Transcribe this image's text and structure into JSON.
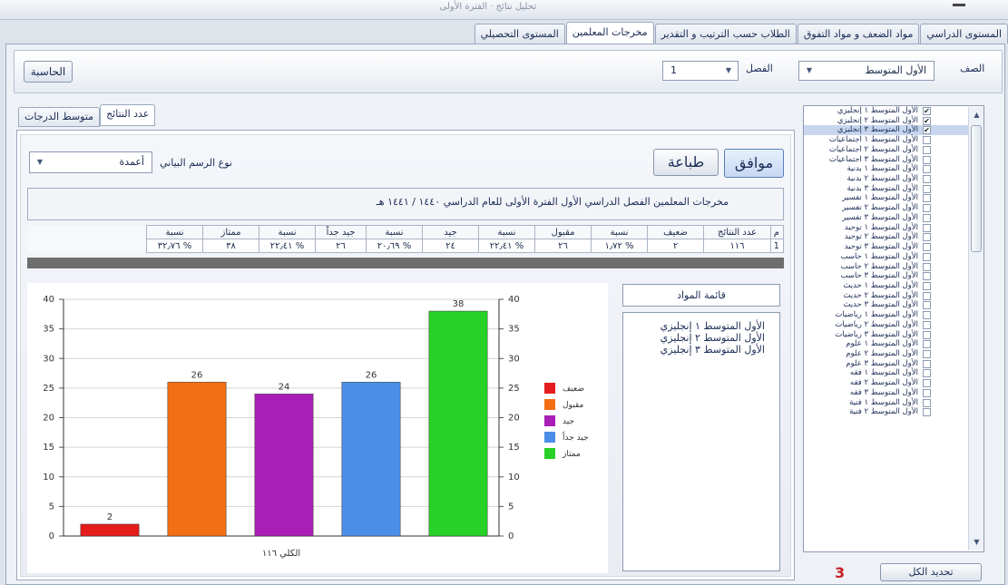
{
  "window": {
    "title": "تحليل نتائج · الفترة الأولى"
  },
  "main_tabs": [
    {
      "label": "المستوى الدراسي",
      "active": false
    },
    {
      "label": "مواد الضعف و مواد التفوق",
      "active": false
    },
    {
      "label": "الطلاب حسب الترتيب و التقدير",
      "active": false
    },
    {
      "label": "مخرجات المعلمين",
      "active": true
    },
    {
      "label": "المستوى التحصيلي",
      "active": false
    }
  ],
  "toolbar": {
    "class_label": "الصف",
    "class_value": "الأول المتوسط",
    "section_label": "الفصل",
    "section_value": "1",
    "calc_button": "الحاسبة"
  },
  "sub_tabs": [
    {
      "label": "متوسط الدرجات",
      "active": false
    },
    {
      "label": "عدد النتائج",
      "active": true
    }
  ],
  "chart_controls": {
    "type_label": "نوع الرسم البياني",
    "type_value": "أعمدة",
    "print_button": "طباعة",
    "ok_button": "موافق"
  },
  "report_title": "مخرجات المعلمين الفصل الدراسي الأول الفترة الأولى للعام الدراسي ١٤٤٠ / ١٤٤١ هـ",
  "stats_table": {
    "headers": [
      "م",
      "عدد النتائج",
      "ضعيف",
      "نسبة",
      "مقبول",
      "نسبة",
      "جيد",
      "نسبة",
      "جيد جداً",
      "نسبة",
      "ممتاز",
      "نسبة"
    ],
    "row": [
      "1",
      "١١٦",
      "٢",
      "% ١٫٧٢",
      "٢٦",
      "% ٢٢٫٤١",
      "٢٤",
      "% ٢٠٫٦٩",
      "٢٦",
      "% ٢٢٫٤١",
      "٣٨",
      "% ٣٢٫٧٦"
    ]
  },
  "chart_data": {
    "type": "bar",
    "categories": [
      "ضعيف",
      "مقبول",
      "جيد",
      "جيد جداً",
      "ممتاز"
    ],
    "values": [
      2,
      26,
      24,
      26,
      38
    ],
    "colors": [
      "#e41c1c",
      "#f36f13",
      "#a91eb6",
      "#4a8ee8",
      "#27d127"
    ],
    "ylim": [
      0,
      40
    ],
    "yticks": [
      "0",
      "5",
      "10",
      "15",
      "20",
      "25",
      "30",
      "35",
      "40"
    ],
    "xlabel": "الكلي ١١٦",
    "grid": true,
    "legend": "right"
  },
  "subjects": {
    "header": "قائمة المواد",
    "items": [
      "الأول المتوسط ١ إنجليزي",
      "الأول المتوسط ٢ إنجليزي",
      "الأول المتوسط ٣ إنجليزي"
    ]
  },
  "class_list": [
    {
      "label": "الأول المتوسط ١ إنجليزي",
      "checked": true,
      "selected": false
    },
    {
      "label": "الأول المتوسط ٢ إنجليزي",
      "checked": true,
      "selected": false
    },
    {
      "label": "الأول المتوسط ٣ إنجليزي",
      "checked": true,
      "selected": true
    },
    {
      "label": "الأول المتوسط ١ اجتماعيات",
      "checked": false,
      "selected": false
    },
    {
      "label": "الأول المتوسط ٢ اجتماعيات",
      "checked": false,
      "selected": false
    },
    {
      "label": "الأول المتوسط ٣ اجتماعيات",
      "checked": false,
      "selected": false
    },
    {
      "label": "الأول المتوسط ١ بدنية",
      "checked": false,
      "selected": false
    },
    {
      "label": "الأول المتوسط ٢ بدنية",
      "checked": false,
      "selected": false
    },
    {
      "label": "الأول المتوسط ٣ بدنية",
      "checked": false,
      "selected": false
    },
    {
      "label": "الأول المتوسط ١ تفسير",
      "checked": false,
      "selected": false
    },
    {
      "label": "الأول المتوسط ٢ تفسير",
      "checked": false,
      "selected": false
    },
    {
      "label": "الأول المتوسط ٣ تفسير",
      "checked": false,
      "selected": false
    },
    {
      "label": "الأول المتوسط ١ توحيد",
      "checked": false,
      "selected": false
    },
    {
      "label": "الأول المتوسط ٢ توحيد",
      "checked": false,
      "selected": false
    },
    {
      "label": "الأول المتوسط ٣ توحيد",
      "checked": false,
      "selected": false
    },
    {
      "label": "الأول المتوسط ١ حاسب",
      "checked": false,
      "selected": false
    },
    {
      "label": "الأول المتوسط ٢ حاسب",
      "checked": false,
      "selected": false
    },
    {
      "label": "الأول المتوسط ٣ حاسب",
      "checked": false,
      "selected": false
    },
    {
      "label": "الأول المتوسط ١ حديث",
      "checked": false,
      "selected": false
    },
    {
      "label": "الأول المتوسط ٢ حديث",
      "checked": false,
      "selected": false
    },
    {
      "label": "الأول المتوسط ٣ حديث",
      "checked": false,
      "selected": false
    },
    {
      "label": "الأول المتوسط ١ رياضيات",
      "checked": false,
      "selected": false
    },
    {
      "label": "الأول المتوسط ٢ رياضيات",
      "checked": false,
      "selected": false
    },
    {
      "label": "الأول المتوسط ٣ رياضيات",
      "checked": false,
      "selected": false
    },
    {
      "label": "الأول المتوسط ١ علوم",
      "checked": false,
      "selected": false
    },
    {
      "label": "الأول المتوسط ٢ علوم",
      "checked": false,
      "selected": false
    },
    {
      "label": "الأول المتوسط ٣ علوم",
      "checked": false,
      "selected": false
    },
    {
      "label": "الأول المتوسط ١ فقه",
      "checked": false,
      "selected": false
    },
    {
      "label": "الأول المتوسط ٢ فقه",
      "checked": false,
      "selected": false
    },
    {
      "label": "الأول المتوسط ٣ فقه",
      "checked": false,
      "selected": false
    },
    {
      "label": "الأول المتوسط ١ فنية",
      "checked": false,
      "selected": false
    },
    {
      "label": "الأول المتوسط ٢ فنية",
      "checked": false,
      "selected": false
    }
  ],
  "select_all_button": "تحديد الكل",
  "selected_count": "3"
}
